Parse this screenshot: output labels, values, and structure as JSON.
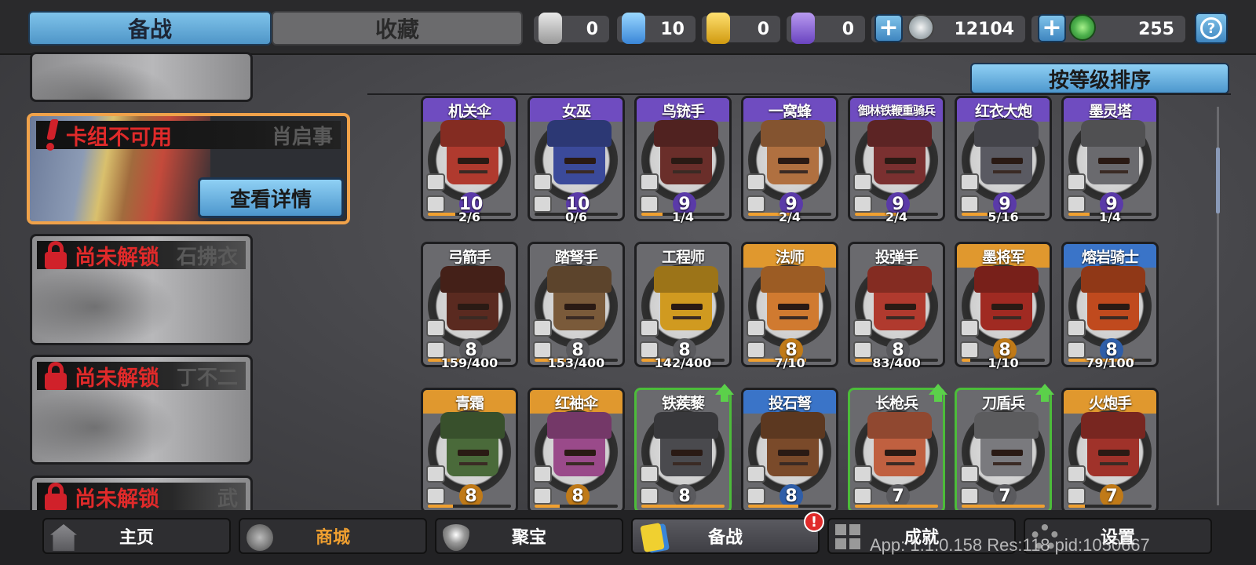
{
  "top_tabs": {
    "active": "备战",
    "inactive": "收藏"
  },
  "resources": [
    {
      "icon": "silver-token-icon",
      "value": "0",
      "color": "#c8c8c8"
    },
    {
      "icon": "blue-crystal-icon",
      "value": "10",
      "color": "#5ab4f0"
    },
    {
      "icon": "gold-token-icon",
      "value": "0",
      "color": "#f0c030"
    },
    {
      "icon": "purple-token-icon",
      "value": "0",
      "color": "#8a66d8"
    },
    {
      "icon": "silver-coin-icon",
      "value": "12104",
      "color": "#c0c8cc"
    },
    {
      "icon": "jade-coin-icon",
      "value": "255",
      "color": "#4cb04c"
    }
  ],
  "decks": [
    {
      "status": "卡组不可用",
      "name": "肖启事",
      "button": "查看详情",
      "selected": true
    },
    {
      "status": "尚未解锁",
      "name": "石拂衣",
      "selected": false
    },
    {
      "status": "尚未解锁",
      "name": "丁不二",
      "selected": false
    },
    {
      "status": "尚未解锁",
      "name": "武",
      "selected": false
    }
  ],
  "sort_button": "按等级排序",
  "rarity_colors": {
    "purple": "#6f4cc0",
    "orange": "#e0982e",
    "blue": "#3a74c8"
  },
  "cards": [
    {
      "name": "机关伞",
      "rarity": "purple",
      "level": "10",
      "progress": "2/6",
      "fill": 0.33,
      "color": "#b03a2e"
    },
    {
      "name": "女巫",
      "rarity": "purple",
      "level": "10",
      "progress": "0/6",
      "fill": 0.0,
      "color": "#3b4a9a"
    },
    {
      "name": "鸟铳手",
      "rarity": "purple",
      "level": "9",
      "progress": "1/4",
      "fill": 0.25,
      "color": "#6a2e2a"
    },
    {
      "name": "一窝蜂",
      "rarity": "purple",
      "level": "9",
      "progress": "2/4",
      "fill": 0.5,
      "color": "#b07040"
    },
    {
      "name": "御林铁鞭重骑兵",
      "rarity": "purple",
      "level": "9",
      "progress": "2/4",
      "fill": 0.5,
      "color": "#7a3030"
    },
    {
      "name": "红衣大炮",
      "rarity": "purple",
      "level": "9",
      "progress": "5/16",
      "fill": 0.31,
      "color": "#5a5a62"
    },
    {
      "name": "墨灵塔",
      "rarity": "purple",
      "level": "9",
      "progress": "1/4",
      "fill": 0.25,
      "color": "#6a6a6e"
    },
    {
      "name": "弓箭手",
      "rarity": "none",
      "level": "8",
      "progress": "159/400",
      "fill": 0.4,
      "color": "#5a2a20"
    },
    {
      "name": "踏弩手",
      "rarity": "none",
      "level": "8",
      "progress": "153/400",
      "fill": 0.38,
      "color": "#7a5a3a"
    },
    {
      "name": "工程师",
      "rarity": "none",
      "level": "8",
      "progress": "142/400",
      "fill": 0.36,
      "color": "#d09a20"
    },
    {
      "name": "法师",
      "rarity": "orange",
      "level": "8",
      "progress": "7/10",
      "fill": 0.7,
      "color": "#d07a30"
    },
    {
      "name": "投弹手",
      "rarity": "none",
      "level": "8",
      "progress": "83/400",
      "fill": 0.21,
      "color": "#b03a2e"
    },
    {
      "name": "墨将军",
      "rarity": "orange",
      "level": "8",
      "progress": "1/10",
      "fill": 0.1,
      "color": "#a02a22"
    },
    {
      "name": "熔岩骑士",
      "rarity": "blue",
      "level": "8",
      "progress": "79/100",
      "fill": 0.79,
      "color": "#c04a1e"
    },
    {
      "name": "青霜",
      "rarity": "orange",
      "level": "8",
      "progress": "",
      "fill": 0.3,
      "color": "#4a6a3a"
    },
    {
      "name": "红袖伞",
      "rarity": "orange",
      "level": "8",
      "progress": "",
      "fill": 0.3,
      "color": "#9a4a8a"
    },
    {
      "name": "铁蒺藜",
      "rarity": "none",
      "level": "8",
      "progress": "",
      "fill": 1.0,
      "color": "#4a4a4e",
      "upgrade": true
    },
    {
      "name": "投石弩",
      "rarity": "blue",
      "level": "8",
      "progress": "",
      "fill": 0.6,
      "color": "#7a4a2a"
    },
    {
      "name": "长枪兵",
      "rarity": "none",
      "level": "7",
      "progress": "",
      "fill": 1.0,
      "color": "#c06040",
      "upgrade": true
    },
    {
      "name": "刀盾兵",
      "rarity": "none",
      "level": "7",
      "progress": "",
      "fill": 1.0,
      "color": "#7a7a7e",
      "upgrade": true
    },
    {
      "name": "火炮手",
      "rarity": "orange",
      "level": "7",
      "progress": "",
      "fill": 0.2,
      "color": "#a0322a"
    }
  ],
  "nav": [
    {
      "label": "主页",
      "icon": "home-icon",
      "color": "#ffffff"
    },
    {
      "label": "商城",
      "icon": "shop-coins-icon",
      "color": "#f0a030"
    },
    {
      "label": "聚宝",
      "icon": "treasure-eye-icon",
      "color": "#ffffff"
    },
    {
      "label": "备战",
      "icon": "deck-cards-icon",
      "color": "#ffffff",
      "active": true
    },
    {
      "label": "成就",
      "icon": "achievement-grid-icon",
      "color": "#ffffff"
    },
    {
      "label": "设置",
      "icon": "settings-gear-icon",
      "color": "#ffffff"
    }
  ],
  "nav_badge": "!",
  "debug_text": "App: 1.1.0.158 Res:118 pid:1050667"
}
